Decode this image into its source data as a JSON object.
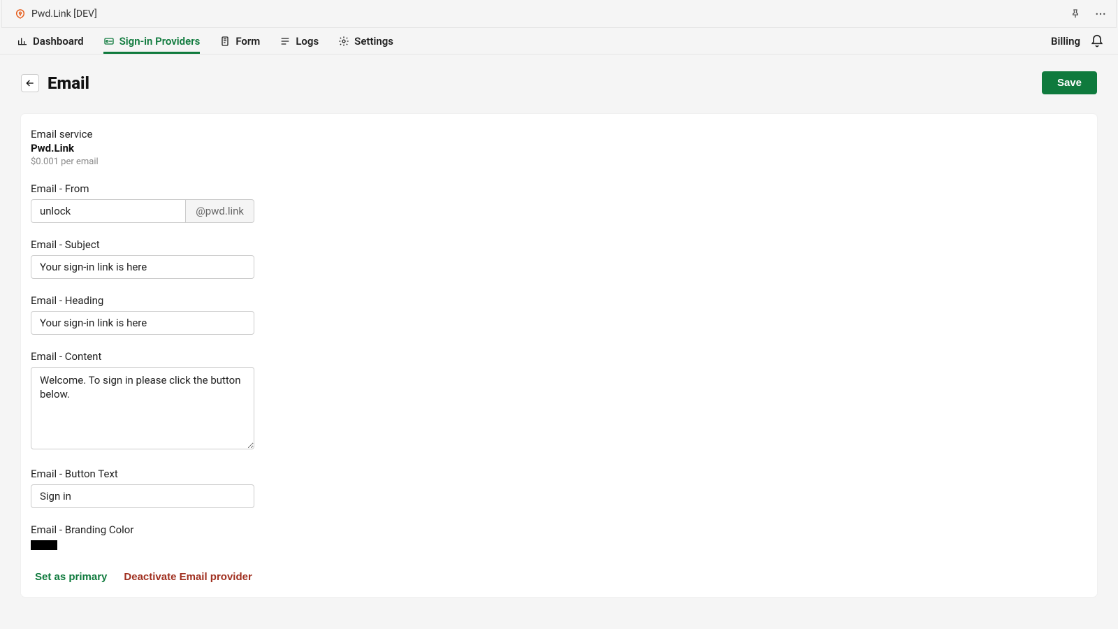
{
  "window": {
    "title": "Pwd.Link [DEV]"
  },
  "nav": {
    "items": [
      {
        "label": "Dashboard"
      },
      {
        "label": "Sign-in Providers"
      },
      {
        "label": "Form"
      },
      {
        "label": "Logs"
      },
      {
        "label": "Settings"
      }
    ],
    "billing_label": "Billing"
  },
  "page": {
    "title": "Email",
    "save_label": "Save"
  },
  "service": {
    "label": "Email service",
    "name": "Pwd.Link",
    "price": "$0.001 per email"
  },
  "fields": {
    "from": {
      "label": "Email - From",
      "value": "unlock",
      "addon": "@pwd.link"
    },
    "subject": {
      "label": "Email - Subject",
      "value": "Your sign-in link is here"
    },
    "heading": {
      "label": "Email - Heading",
      "value": "Your sign-in link is here"
    },
    "content": {
      "label": "Email - Content",
      "value": "Welcome. To sign in please click the button below."
    },
    "button_text": {
      "label": "Email - Button Text",
      "value": "Sign in"
    },
    "branding_color": {
      "label": "Email - Branding Color",
      "value": "#000000"
    }
  },
  "actions": {
    "set_primary": "Set as primary",
    "deactivate": "Deactivate Email provider"
  }
}
